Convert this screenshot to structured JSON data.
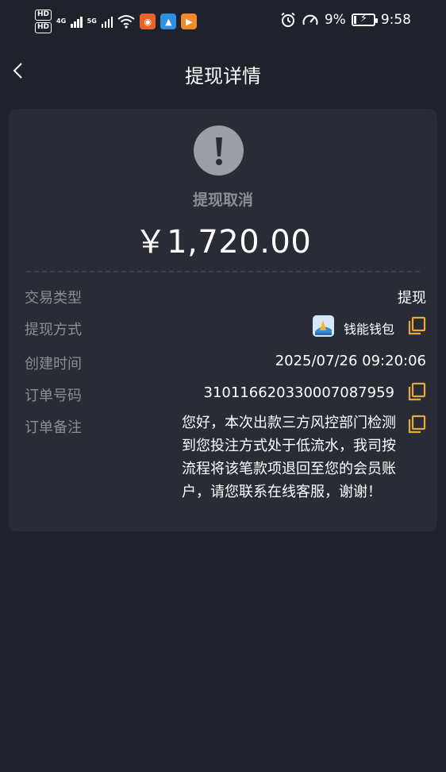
{
  "status_bar": {
    "hd1": "HD",
    "hd2": "HD",
    "net1": "4G",
    "net2": "5G",
    "battery": "9%",
    "time": "9:58"
  },
  "nav": {
    "title": "提现详情"
  },
  "summary": {
    "status": "提现取消",
    "amount": "￥1,720.00"
  },
  "details": {
    "type_label": "交易类型",
    "type_value": "提现",
    "method_label": "提现方式",
    "method_value": "钱能钱包",
    "created_label": "创建时间",
    "created_value": "2025/07/26 09:20:06",
    "order_label": "订单号码",
    "order_value": "310116620330007087959",
    "remark_label": "订单备注",
    "remark_value": "您好，本次出款三方风控部门检测到您投注方式处于低流水，我司按流程将该笔款项退回至您的会员账户，请您联系在线客服，谢谢！"
  },
  "colors": {
    "background": "#1f222b",
    "card": "#292c35",
    "accent_copy": "#e6a93a",
    "muted_text": "#8a8d94"
  }
}
